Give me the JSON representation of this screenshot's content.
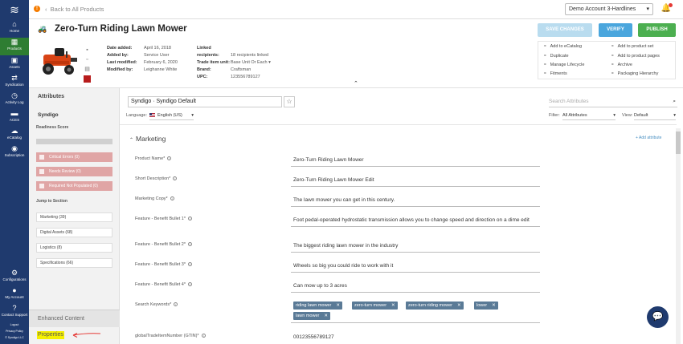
{
  "nav": {
    "items": [
      {
        "label": "Home",
        "icon": "home-icon",
        "glyph": "⌂"
      },
      {
        "label": "Products",
        "icon": "products-icon",
        "glyph": "▦"
      },
      {
        "label": "Assets",
        "icon": "assets-icon",
        "glyph": "▣"
      },
      {
        "label": "Syndication",
        "icon": "syndication-icon",
        "glyph": "⇄"
      },
      {
        "label": "Activity Log",
        "icon": "activity-log-icon",
        "glyph": "◷"
      },
      {
        "label": "ACES",
        "icon": "aces-icon",
        "glyph": "▬"
      },
      {
        "label": "eCatalog",
        "icon": "ecatalog-icon",
        "glyph": "☁"
      },
      {
        "label": "Subscription",
        "icon": "subscription-icon",
        "glyph": "◉"
      }
    ],
    "bottom": [
      {
        "label": "Configurations",
        "icon": "configurations-icon",
        "glyph": "⚙"
      },
      {
        "label": "My Account",
        "icon": "my-account-icon",
        "glyph": "●"
      },
      {
        "label": "Contact Support",
        "icon": "contact-support-icon",
        "glyph": "?"
      }
    ],
    "footer": {
      "logout": "Logout",
      "privacy": "Privacy Policy",
      "brand": "© Syndigo LLC"
    },
    "active_color": "#2e7d32",
    "bg_color": "#1f3a6e"
  },
  "topbar": {
    "alert": "!",
    "back_label": "Back to All Products",
    "account": "Demo Account 3-Hardlines"
  },
  "product": {
    "title": "Zero-Turn Riding Lawn Mower",
    "meta_left": [
      {
        "key": "Date added:",
        "value": "April 16, 2018"
      },
      {
        "key": "Added by:",
        "value": "Service User"
      },
      {
        "key": "Last modified:",
        "value": "February 6, 2020"
      },
      {
        "key": "Modified by:",
        "value": "Leighanne White"
      }
    ],
    "meta_right": [
      {
        "key": "Linked recipients:",
        "value": "18 recipients linked"
      },
      {
        "key": "Trade item unit:",
        "value": "Base Unit Or Each"
      },
      {
        "key": "Brand:",
        "value": "Craftsman"
      },
      {
        "key": "UPC:",
        "value": "123556789127"
      }
    ],
    "buttons": {
      "save": "SAVE CHANGES",
      "verify": "VERIFY",
      "publish": "PUBLISH"
    },
    "actions": [
      {
        "label": "Add to eCatalog",
        "icon": "link-icon"
      },
      {
        "label": "Add to product set",
        "icon": "link-icon"
      },
      {
        "label": "Duplicate",
        "icon": "link-icon"
      },
      {
        "label": "Add to product pages",
        "icon": "link-icon"
      },
      {
        "label": "Manage Lifecycle",
        "icon": "link-icon"
      },
      {
        "label": "Archive",
        "icon": "link-icon"
      },
      {
        "label": "Fitments",
        "icon": "link-icon"
      },
      {
        "label": "Packaging Hierarchy",
        "icon": "link-icon"
      }
    ]
  },
  "attributes_panel": {
    "header": "Attributes",
    "source": "Syndigo",
    "readiness_label": "Readiness Score",
    "errors": [
      "Critical Errors (0)",
      "Needs Review (0)",
      "Required Not Populated (0)"
    ],
    "jump_label": "Jump to Section",
    "sections": [
      "Marketing (39)",
      "Digital Assets (68)",
      "Logistics (8)",
      "Specifications (66)"
    ],
    "enhanced": "Enhanced Content",
    "properties": "Properties"
  },
  "main": {
    "context": "Syndigo  ·  Syndigo Default",
    "search_placeholder": "Search Attributes",
    "language_label": "Language:",
    "language_value": "English (US)",
    "filter_label": "Filter:",
    "filter_value": "All Attributes",
    "view_label": "View:",
    "view_value": "Default",
    "section": "Marketing",
    "add_attribute": "+ Add attribute",
    "fields": [
      {
        "label": "Product Name*",
        "value": "Zero-Turn Riding Lawn Mower"
      },
      {
        "label": "Short Description*",
        "value": "Zero-Turn Riding Lawn Mower Edit"
      },
      {
        "label": "Marketing Copy*",
        "value": "The lawn mower you can get in this century."
      },
      {
        "label": "Feature - Benefit Bullet 1*",
        "value": "Foot pedal-operated hydrostatic transmission allows you to change speed and direction on a dime edit"
      },
      {
        "label": "Feature - Benefit Bullet 2*",
        "value": "The biggest riding lawn mower in the industry"
      },
      {
        "label": "Feature - Benefit Bullet 3*",
        "value": "Wheels so big you could ride to work with it"
      },
      {
        "label": "Feature - Benefit Bullet 4*",
        "value": "Can mow up to 3 acres"
      }
    ],
    "keywords_label": "Search Keywords*",
    "keywords": [
      "riding lawn mower",
      "zero-turn mower",
      "zero-turn riding mower",
      "lower",
      "lawn mower"
    ],
    "gtin_label": "globalTradeItemNumber (GTIN)*",
    "gtin_value": "00123556789127"
  }
}
